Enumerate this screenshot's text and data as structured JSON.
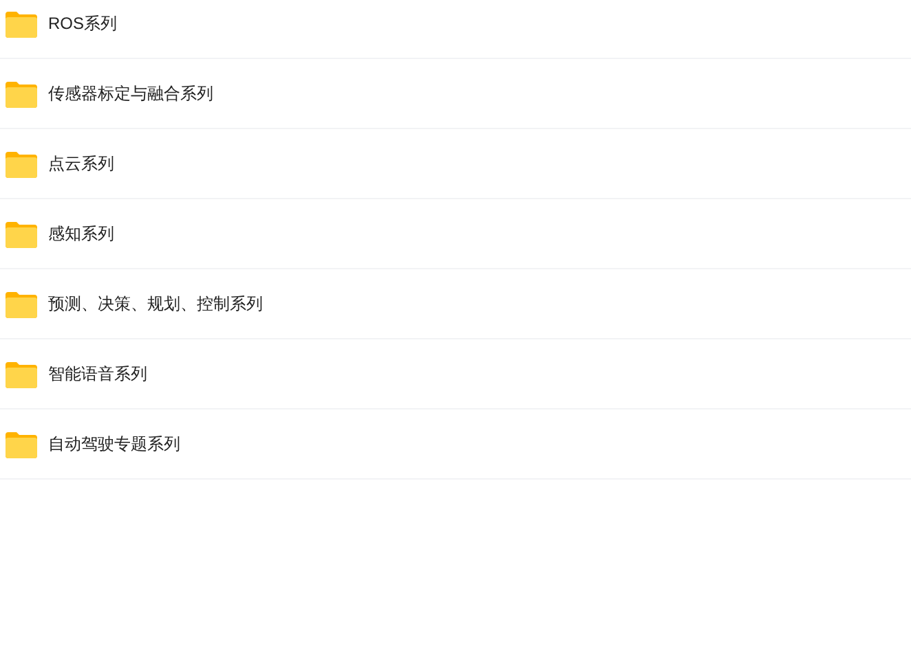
{
  "folders": [
    {
      "name": "ROS系列"
    },
    {
      "name": "传感器标定与融合系列"
    },
    {
      "name": "点云系列"
    },
    {
      "name": "感知系列"
    },
    {
      "name": "预测、决策、规划、控制系列"
    },
    {
      "name": "智能语音系列"
    },
    {
      "name": "自动驾驶专题系列"
    }
  ]
}
